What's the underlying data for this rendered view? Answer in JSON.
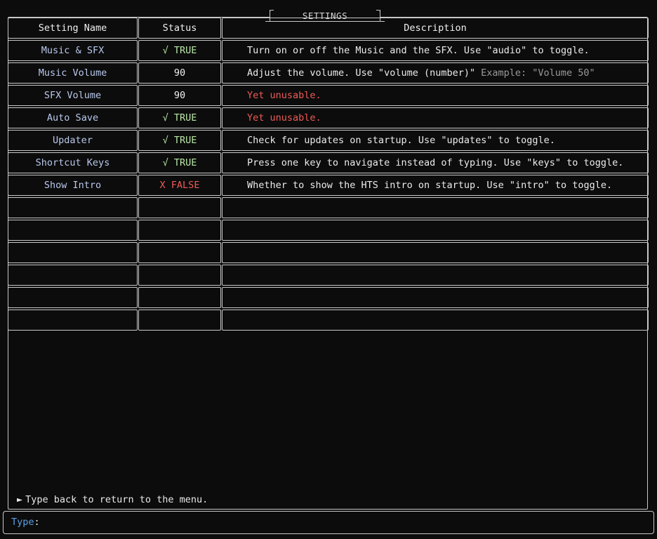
{
  "window": {
    "title": "SETTINGS"
  },
  "table": {
    "headers": {
      "name": "Setting Name",
      "status": "Status",
      "description": "Description"
    },
    "rows": [
      {
        "name": "Music & SFX",
        "status": "√ TRUE",
        "status_kind": "true",
        "description": "Turn on or off the Music and the SFX. Use \"audio\" to toggle.",
        "description_extra": ""
      },
      {
        "name": "Music Volume",
        "status": "90",
        "status_kind": "number",
        "description": "Adjust the volume. Use \"volume (number)\"",
        "description_extra": "Example: \"Volume 50\""
      },
      {
        "name": "SFX Volume",
        "status": "90",
        "status_kind": "number",
        "description": "Yet unusable.",
        "description_extra": ""
      },
      {
        "name": "Auto Save",
        "status": "√ TRUE",
        "status_kind": "true",
        "description": "Yet unusable.",
        "description_extra": ""
      },
      {
        "name": "Updater",
        "status": "√ TRUE",
        "status_kind": "true",
        "description": "Check for updates on startup. Use \"updates\" to toggle.",
        "description_extra": ""
      },
      {
        "name": "Shortcut Keys",
        "status": "√ TRUE",
        "status_kind": "true",
        "description": "Press one key to navigate instead of typing. Use \"keys\" to toggle.",
        "description_extra": ""
      },
      {
        "name": "Show Intro",
        "status": "X FALSE",
        "status_kind": "false",
        "description": "Whether to show the HTS intro on startup. Use \"intro\" to toggle.",
        "description_extra": ""
      }
    ],
    "empty_row_count": 6
  },
  "hint": {
    "arrow": "►",
    "text": "Type back to return to the menu."
  },
  "input": {
    "label": "Type",
    "separator": ":",
    "value": ""
  },
  "colors": {
    "background": "#0c0c0c",
    "border": "#c8c8c8",
    "setting_name": "#b9c8ec",
    "true_status": "#b8e6a4",
    "false_status": "#f05a55",
    "warning_text": "#f05a55",
    "muted_text": "#9a9a9a",
    "input_label": "#5aa0ea"
  }
}
